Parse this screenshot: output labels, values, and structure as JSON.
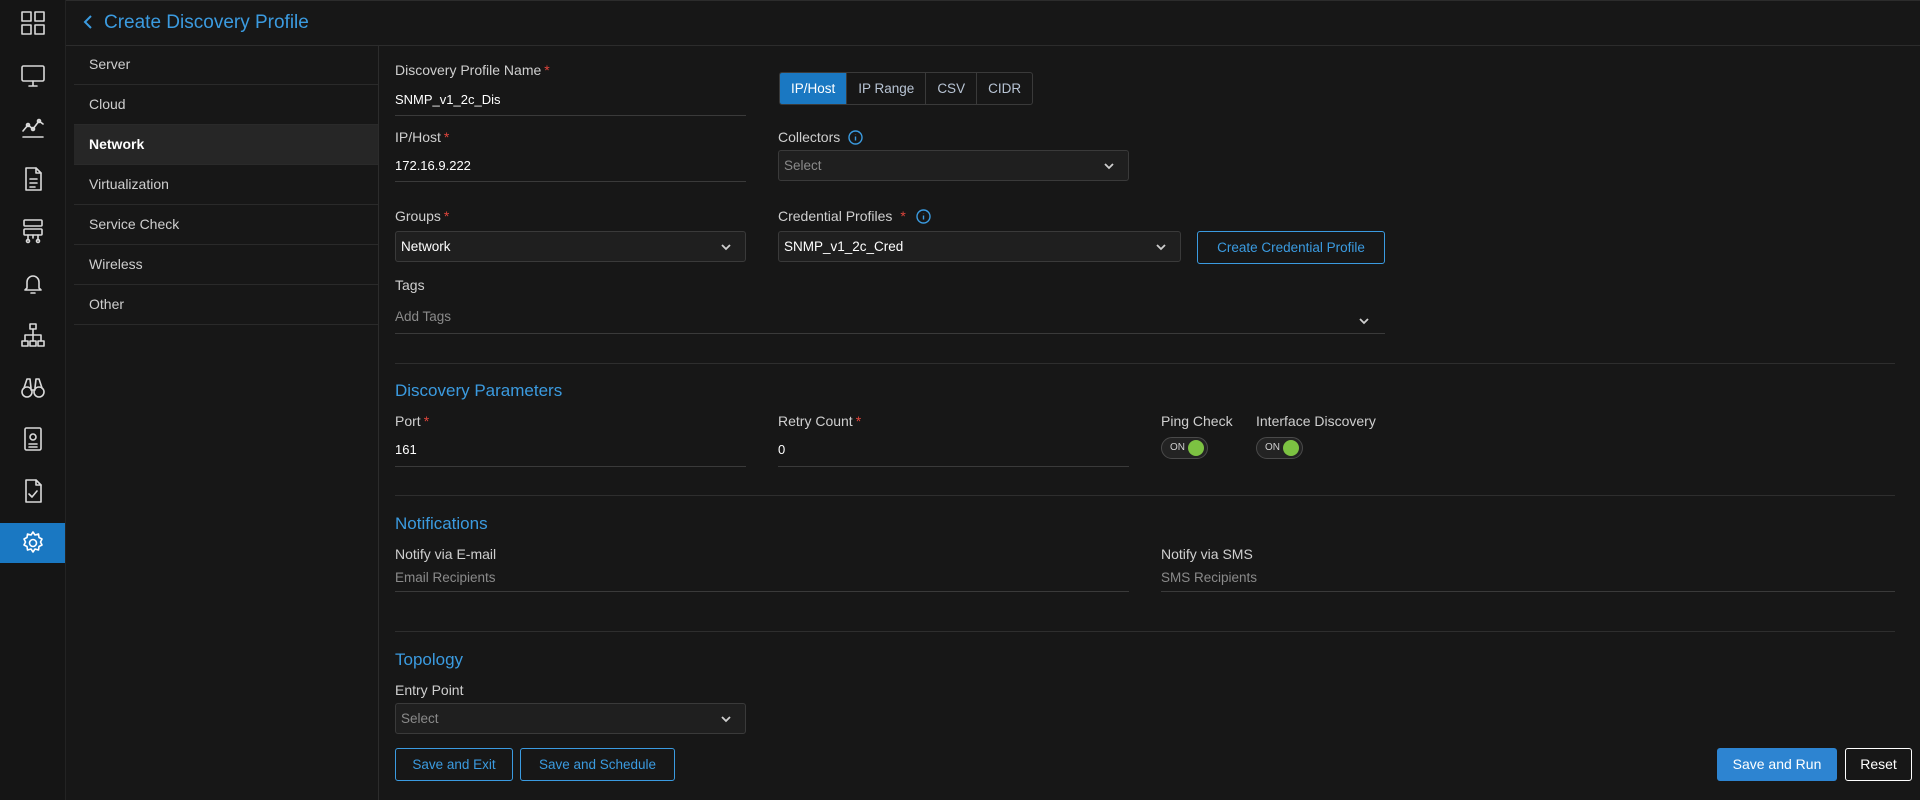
{
  "header": {
    "title": "Create Discovery Profile"
  },
  "rail": {
    "icons": [
      "grid-icon",
      "monitor-icon",
      "chart-icon",
      "document-icon",
      "network-device-icon",
      "bell-icon",
      "topology-icon",
      "binoculars-icon",
      "report-icon",
      "checklist-icon",
      "gear-icon"
    ],
    "active_index": 10,
    "accent": "#1a78c2"
  },
  "categories": [
    "Server",
    "Cloud",
    "Network",
    "Virtualization",
    "Service Check",
    "Wireless",
    "Other"
  ],
  "active_category": "Network",
  "form": {
    "profile_name": {
      "label": "Discovery Profile Name",
      "value": "SNMP_v1_2c_Dis"
    },
    "mode_tabs": [
      "IP/Host",
      "IP Range",
      "CSV",
      "CIDR"
    ],
    "active_mode": "IP/Host",
    "ip_host": {
      "label": "IP/Host",
      "value": "172.16.9.222"
    },
    "collectors": {
      "label": "Collectors",
      "placeholder": "Select"
    },
    "groups": {
      "label": "Groups",
      "value": "Network"
    },
    "credential_profiles": {
      "label": "Credential Profiles",
      "value": "SNMP_v1_2c_Cred"
    },
    "create_credential_label": "Create Credential Profile",
    "tags": {
      "label": "Tags",
      "placeholder": "Add Tags"
    }
  },
  "discovery_parameters": {
    "title": "Discovery Parameters",
    "port": {
      "label": "Port",
      "value": "161"
    },
    "retry": {
      "label": "Retry Count",
      "value": "0"
    },
    "ping_check": {
      "label": "Ping Check",
      "state": "ON"
    },
    "interface_discovery": {
      "label": "Interface Discovery",
      "state": "ON"
    }
  },
  "notifications": {
    "title": "Notifications",
    "email": {
      "label": "Notify via E-mail",
      "placeholder": "Email Recipients"
    },
    "sms": {
      "label": "Notify via SMS",
      "placeholder": "SMS Recipients"
    }
  },
  "topology": {
    "title": "Topology",
    "entry_point": {
      "label": "Entry Point",
      "placeholder": "Select"
    }
  },
  "footer": {
    "save_exit": "Save and Exit",
    "save_schedule": "Save and Schedule",
    "save_run": "Save and Run",
    "reset": "Reset"
  }
}
